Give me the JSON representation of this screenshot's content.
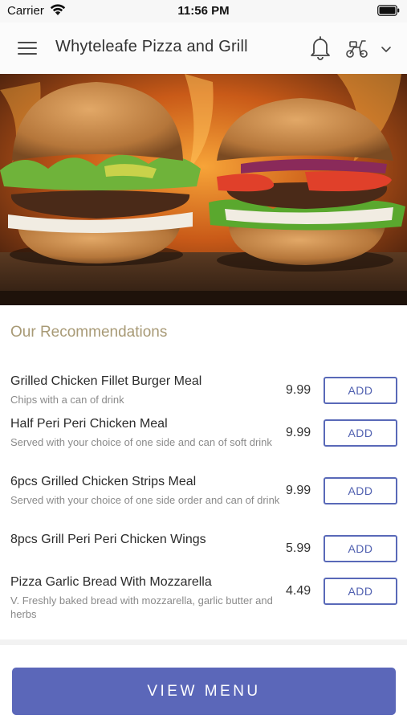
{
  "status_bar": {
    "carrier": "Carrier",
    "time": "11:56 PM"
  },
  "header": {
    "title": "Whyteleafe Pizza and Grill",
    "icons": [
      "menu-icon",
      "bell-icon",
      "scooter-icon",
      "chevron-down-icon"
    ]
  },
  "hero": {
    "image": "burgers-photo"
  },
  "recommendations": {
    "heading": "Our Recommendations",
    "add_label": "ADD",
    "items": [
      {
        "name": "Grilled Chicken Fillet Burger Meal",
        "desc": "Chips with a can of drink",
        "price": "9.99"
      },
      {
        "name": "Half Peri Peri Chicken Meal",
        "desc": "Served with your choice of one side and can of soft drink",
        "price": "9.99"
      },
      {
        "name": "6pcs Grilled Chicken Strips Meal",
        "desc": "Served with your choice of one side order and can of drink",
        "price": "9.99"
      },
      {
        "name": "8pcs Grill Peri Peri Chicken Wings",
        "desc": "",
        "price": "5.99"
      },
      {
        "name": "Pizza Garlic Bread With Mozzarella",
        "desc": "V. Freshly baked bread with mozzarella, garlic butter and herbs",
        "price": "4.49"
      }
    ]
  },
  "footer": {
    "view_menu_label": "VIEW MENU"
  },
  "colors": {
    "accent": "#5b67b9",
    "heading_gold": "#a89a76"
  }
}
